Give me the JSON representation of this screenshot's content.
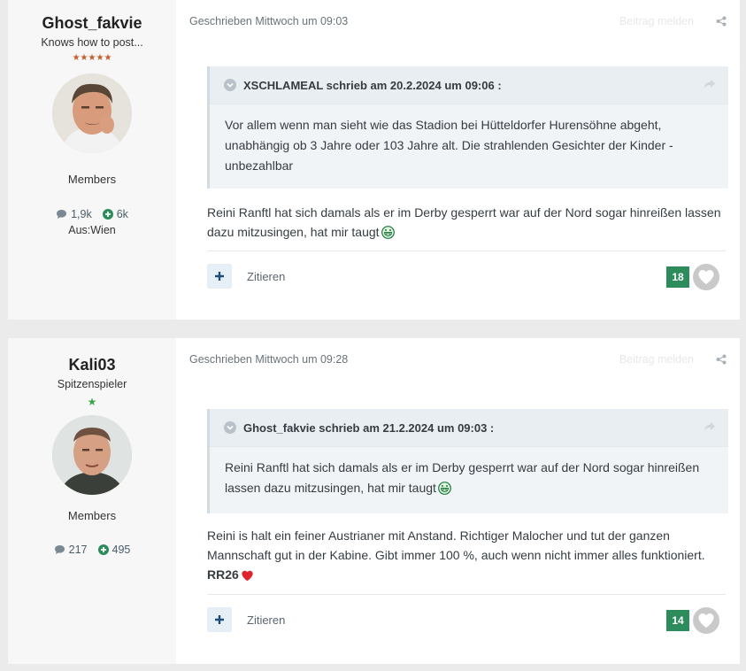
{
  "posts": [
    {
      "author": {
        "name": "Ghost_fakvie",
        "title": "Knows how to post...",
        "stars": "★★★★★",
        "group": "Members",
        "posts_count": "1,9k",
        "reputation": "6k",
        "location": "Aus:Wien"
      },
      "meta": "Geschrieben Mittwoch um 09:03",
      "report": "Beitrag melden",
      "quote": {
        "header": "XSCHLAMEAL schrieb am 20.2.2024 um 09:06 :",
        "body": "Vor allem wenn man sieht wie das Stadion bei Hütteldorfer Hurensöhne abgeht, unabhängig ob 3 Jahre oder 103 Jahre alt. Die strahlenden Gesichter der Kinder - unbezahlbar"
      },
      "text": "Reini Ranftl hat sich damals als er im Derby gesperrt war auf der Nord sogar hinreißen lassen dazu mitzusingen, hat mir taugt",
      "cite_label": "Zitieren",
      "like_count": "18"
    },
    {
      "author": {
        "name": "Kali03",
        "title": "Spitzenspieler",
        "stars": "★",
        "group": "Members",
        "posts_count": "217",
        "reputation": "495"
      },
      "meta": "Geschrieben Mittwoch um 09:28",
      "report": "Beitrag melden",
      "quote": {
        "header": "Ghost_fakvie schrieb am 21.2.2024 um 09:03 :",
        "body": "Reini Ranftl hat sich damals als er im Derby gesperrt war auf der Nord sogar hinreißen lassen dazu mitzusingen, hat mir taugt"
      },
      "text": "Reini is halt ein feiner Austrianer mit Anstand. Richtiger Malocher und tut der ganzen Mannschaft gut in der Kabine. Gibt immer 100 %, auch wenn nicht immer alles funktioniert.",
      "signature": "RR26",
      "cite_label": "Zitieren",
      "like_count": "14"
    }
  ],
  "icons": {
    "comment": "comment-icon",
    "reputation": "plus-circle-icon",
    "share": "share-icon",
    "quote_toggle": "chevron-down-icon",
    "quote_forward": "forward-icon",
    "add": "plus-icon",
    "like": "heart-icon",
    "emoji": "grinning-emoji-icon"
  },
  "colors": {
    "reputation_green": "#2c8c5c",
    "star_orange": "#c35e2e",
    "star_green": "#3aa64c",
    "heart_red": "#e0242c"
  }
}
